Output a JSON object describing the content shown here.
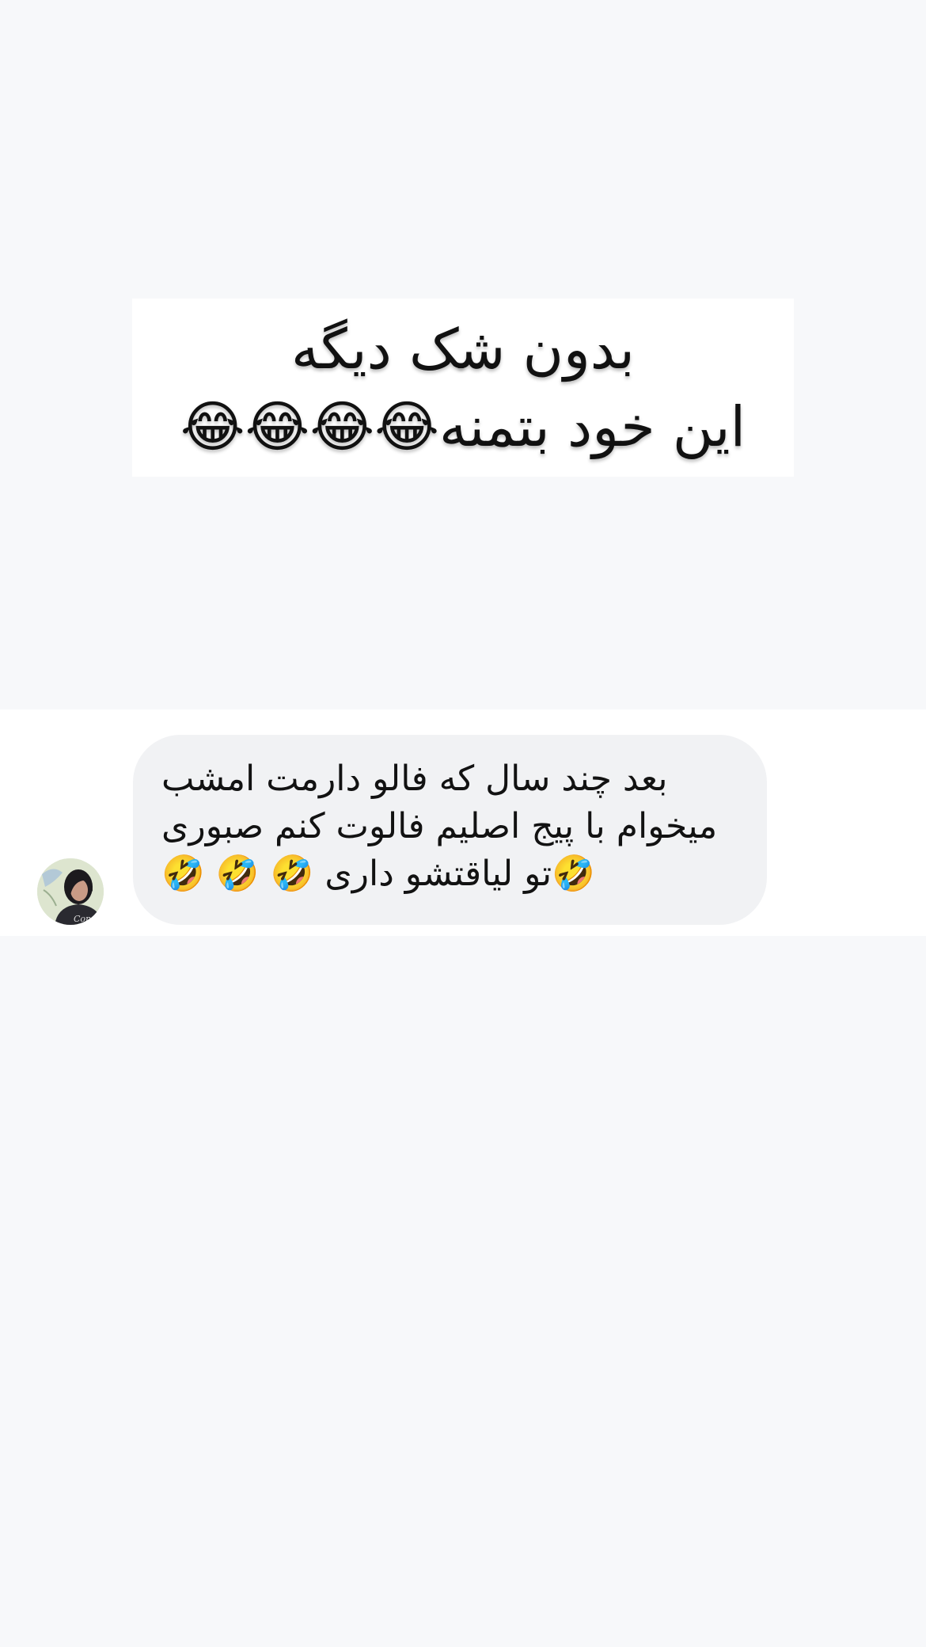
{
  "post_caption": {
    "line1": "بدون شک دیگه",
    "line2": "این خود بتمنه😂😂😂😂"
  },
  "comment": {
    "line1": "بعد چند سال که فالو دارمت امشب",
    "line2": "میخوام با پیج اصلیم فالوت کنم صبوری",
    "line3": "🤣تو لیاقتشو داری 🤣 🤣 🤣"
  },
  "colors": {
    "page_background": "#f7f8fa",
    "bubble_background": "#f1f2f4",
    "text": "#121212"
  }
}
